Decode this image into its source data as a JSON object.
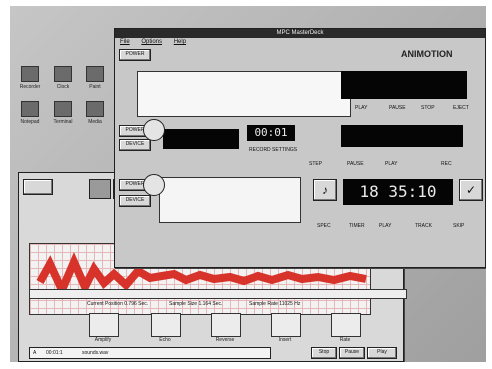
{
  "colors": {
    "accent_red": "#d8332a",
    "window_dark": "#2a2a2a"
  },
  "desktop": {
    "icons": [
      "Recorder",
      "Clock",
      "Paint",
      "Notepad",
      "Terminal",
      "Media"
    ]
  },
  "mpc": {
    "title": "MPC MasterDeck",
    "menu": [
      "File",
      "Options",
      "Help"
    ],
    "brand": "ANIMOTION",
    "rows": [
      {
        "power": "POWER",
        "vol": "VOLUME",
        "display": "",
        "labels": [
          "PLAY",
          "PAUSE",
          "STOP",
          "EJECT"
        ]
      },
      {
        "power": "POWER",
        "device": "DEVICE",
        "display": "00:01",
        "sub": "RECORD SETTINGS",
        "labels": [
          "STEP",
          "PAUSE",
          "PLAY",
          "REC"
        ]
      },
      {
        "power": "POWER",
        "device": "DEVICE",
        "display": "18 35:10",
        "labels": [
          "SPEC",
          "TIMER",
          "PLAY",
          "TRACK",
          "SKIP"
        ]
      }
    ],
    "note_icon": "music-note-icon",
    "check_icon": "checkmark-icon"
  },
  "editor": {
    "status": {
      "position": "Current Position 0.796 Sec.",
      "size": "Sample Size 1.164 Sec.",
      "rate": "Sample Rate 11025 Hz"
    },
    "tools": [
      "Amplify",
      "Echo",
      "Reverse",
      "Insert",
      "Rate"
    ],
    "file_row": {
      "drive": "A",
      "time": "00:01:1",
      "name": "sounds.wav"
    },
    "transport": [
      "Stop",
      "Pause",
      "Play"
    ]
  }
}
